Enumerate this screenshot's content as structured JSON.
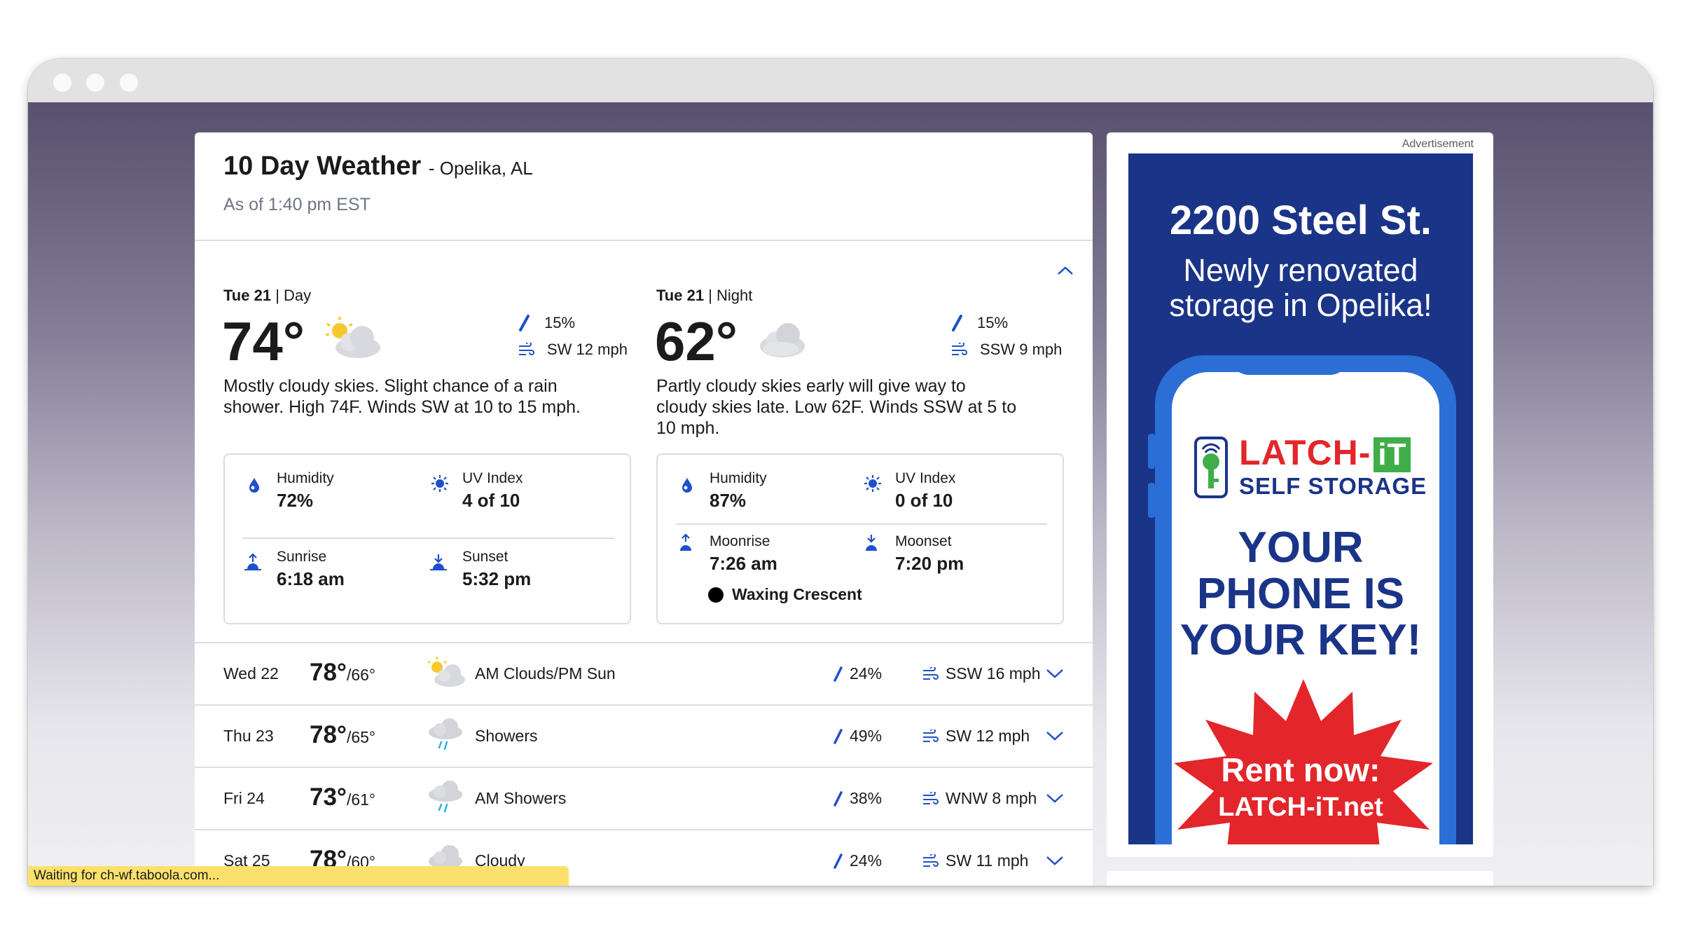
{
  "header": {
    "title": "10 Day Weather",
    "location": "- Opelika, AL",
    "as_of": "As of 1:40 pm EST"
  },
  "today": {
    "day": {
      "date": "Tue 21",
      "period": "| Day",
      "temp": "74°",
      "icon": "mostly-cloudy-icon",
      "precip": "15%",
      "wind": "SW 12 mph",
      "description": "Mostly cloudy skies. Slight chance of a rain shower. High 74F. Winds SW at 10 to 15 mph.",
      "details": {
        "humidity_label": "Humidity",
        "humidity": "72%",
        "uv_label": "UV Index",
        "uv": "4 of 10",
        "sunrise_label": "Sunrise",
        "sunrise": "6:18 am",
        "sunset_label": "Sunset",
        "sunset": "5:32 pm"
      }
    },
    "night": {
      "date": "Tue 21",
      "period": "| Night",
      "temp": "62°",
      "icon": "cloudy-night-icon",
      "precip": "15%",
      "wind": "SSW 9 mph",
      "description": "Partly cloudy skies early will give way to cloudy skies late. Low 62F. Winds SSW at 5 to 10 mph.",
      "details": {
        "humidity_label": "Humidity",
        "humidity": "87%",
        "uv_label": "UV Index",
        "uv": "0 of 10",
        "moonrise_label": "Moonrise",
        "moonrise": "7:26 am",
        "moonset_label": "Moonset",
        "moonset": "7:20 pm",
        "moon_phase": "Waxing Crescent"
      }
    }
  },
  "forecast": [
    {
      "date": "Wed 22",
      "high": "78°",
      "low": "/66°",
      "icon": "partly-cloudy-icon",
      "condition": "AM Clouds/PM Sun",
      "precip": "24%",
      "wind": "SSW 16 mph"
    },
    {
      "date": "Thu 23",
      "high": "78°",
      "low": "/65°",
      "icon": "showers-icon",
      "condition": "Showers",
      "precip": "49%",
      "wind": "SW 12 mph"
    },
    {
      "date": "Fri 24",
      "high": "73°",
      "low": "/61°",
      "icon": "showers-icon",
      "condition": "AM Showers",
      "precip": "38%",
      "wind": "WNW 8 mph"
    },
    {
      "date": "Sat 25",
      "high": "78°",
      "low": "/60°",
      "icon": "cloudy-icon",
      "condition": "Cloudy",
      "precip": "24%",
      "wind": "SW 11 mph"
    }
  ],
  "status_bar": "Waiting for ch-wf.taboola.com...",
  "ad": {
    "label": "Advertisement",
    "headline": "2200 Steel St.",
    "subhead_1": "Newly renovated",
    "subhead_2": "storage in Opelika!",
    "brand_name": "LATCH-",
    "brand_it": "iT",
    "brand_sub": "SELF STORAGE",
    "cta_1": "YOUR",
    "cta_2": "PHONE IS",
    "cta_3": "YOUR KEY!",
    "burst_1": "Rent now:",
    "burst_2": "LATCH-iT.net"
  },
  "colors": {
    "accent_blue": "#1f4fcc",
    "ad_navy": "#1a3487",
    "ad_phone": "#2b6fd6",
    "ad_red": "#e2262b",
    "ad_green": "#3fae49",
    "status_yellow": "#fbe16b"
  }
}
